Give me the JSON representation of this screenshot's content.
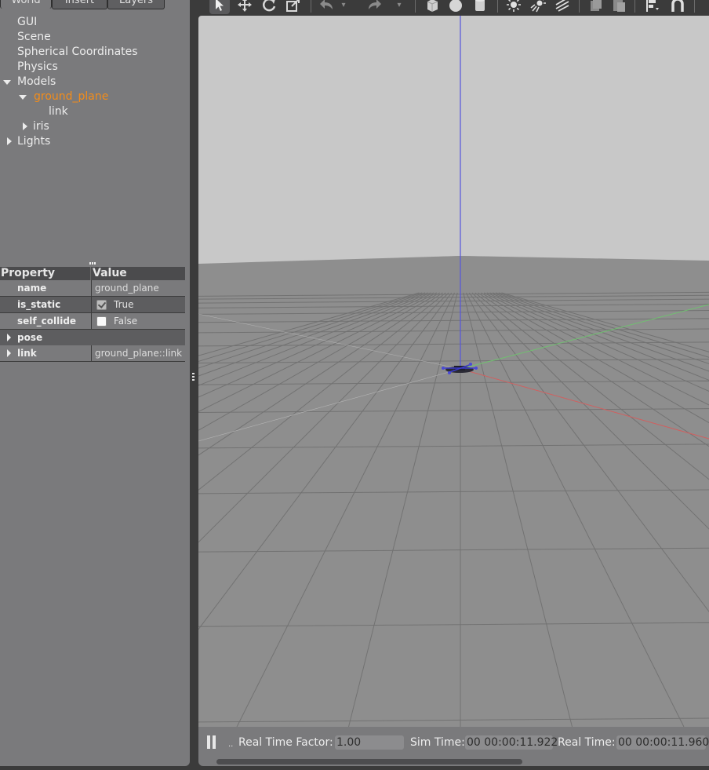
{
  "tabs": [
    {
      "label": "World",
      "active": true
    },
    {
      "label": "Insert",
      "active": false
    },
    {
      "label": "Layers",
      "active": false
    }
  ],
  "world_tree": {
    "gui": "GUI",
    "scene": "Scene",
    "spherical": "Spherical Coordinates",
    "physics": "Physics",
    "models": "Models",
    "ground_plane": "ground_plane",
    "link": "link",
    "iris": "iris",
    "lights": "Lights"
  },
  "properties": {
    "header_property": "Property",
    "header_value": "Value",
    "rows": [
      {
        "name": "name",
        "value": "ground_plane"
      },
      {
        "name": "is_static",
        "value": "True",
        "checked": true
      },
      {
        "name": "self_collide",
        "value": "False",
        "checked": false
      },
      {
        "name": "pose",
        "value": ""
      },
      {
        "name": "link",
        "value": "ground_plane::link"
      }
    ]
  },
  "toolbar": {
    "icons": [
      "select-icon",
      "translate-icon",
      "rotate-icon",
      "scale-icon",
      "undo-icon",
      "undo-dropdown-icon",
      "redo-icon",
      "redo-dropdown-icon",
      "box-icon",
      "sphere-icon",
      "cylinder-icon",
      "point-light-icon",
      "spot-light-icon",
      "directional-light-icon",
      "copy-icon",
      "paste-icon",
      "align-icon",
      "snap-icon"
    ]
  },
  "bottom_bar": {
    "step": "..",
    "rtf_label": "Real Time Factor:",
    "rtf_value": "1.00",
    "sim_label": "Sim Time:",
    "sim_value": "00 00:00:11.922",
    "real_label": "Real Time:",
    "real_value": "00 00:00:11.960"
  },
  "colors": {
    "panel_bg": "#7a7a7c",
    "selected": "#f28c1a",
    "sky": "#c8c8c8",
    "ground": "#8e8e8e",
    "axis_x": "#d06060",
    "axis_y": "#70c070",
    "axis_z": "#5555dd"
  }
}
